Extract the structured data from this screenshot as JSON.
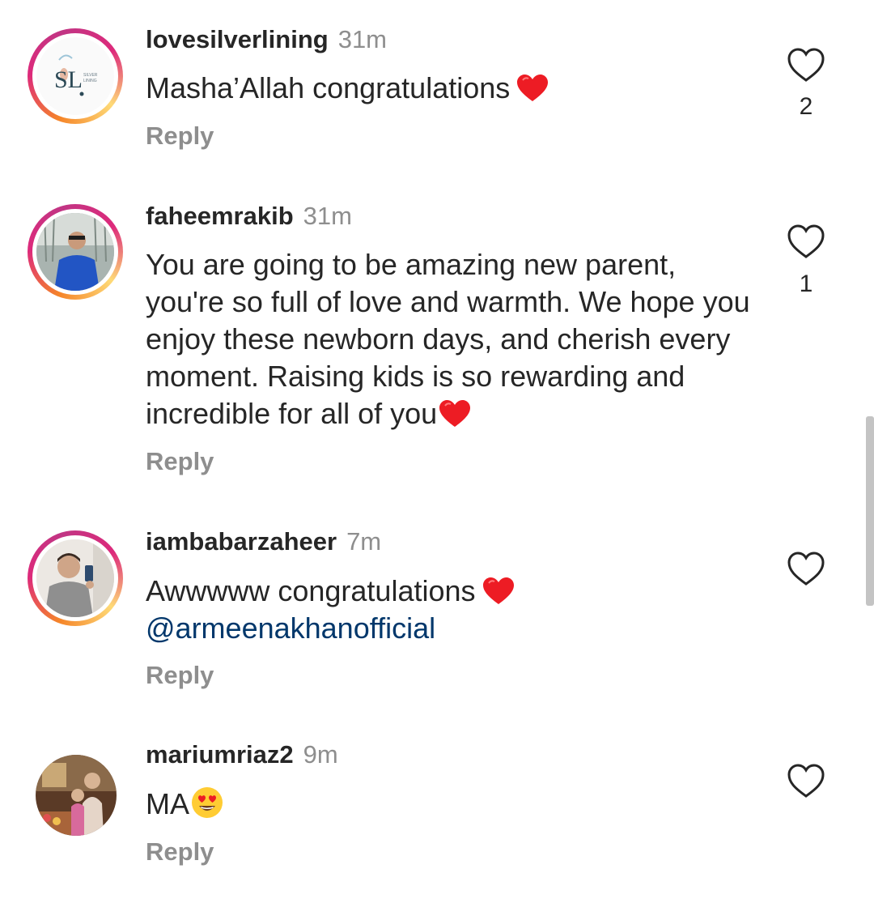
{
  "comments": [
    {
      "username": "lovesilverlining",
      "time": "31m",
      "text": "Masha’Allah congratulations",
      "emoji": "red-heart",
      "reply_label": "Reply",
      "likes": "2",
      "avatar_logo": {
        "mark": "SL",
        "small_text": "SILVER LINING"
      }
    },
    {
      "username": "faheemrakib",
      "time": "31m",
      "text": "You are going to be amazing new parent, you're so full of love and warmth. We hope you enjoy these newborn days, and cherish every moment. Raising kids is so rewarding and incredible for all of you",
      "emoji": "red-heart",
      "reply_label": "Reply",
      "likes": "1"
    },
    {
      "username": "iambabarzaheer",
      "time": "7m",
      "text": "Awwwww congratulations",
      "emoji": "red-heart",
      "mention": "@armeenakhanofficial",
      "reply_label": "Reply"
    },
    {
      "username": "mariumriaz2",
      "time": "9m",
      "text": "MA",
      "emoji": "smiling-face-with-heart-eyes",
      "reply_label": "Reply"
    }
  ],
  "colors": {
    "text": "#262626",
    "secondary": "#8e8e8e",
    "mention": "#00376b",
    "heart": "#ed1c24"
  },
  "icons": [
    "heart-outline-icon",
    "red-heart-emoji",
    "heart-eyes-emoji"
  ]
}
